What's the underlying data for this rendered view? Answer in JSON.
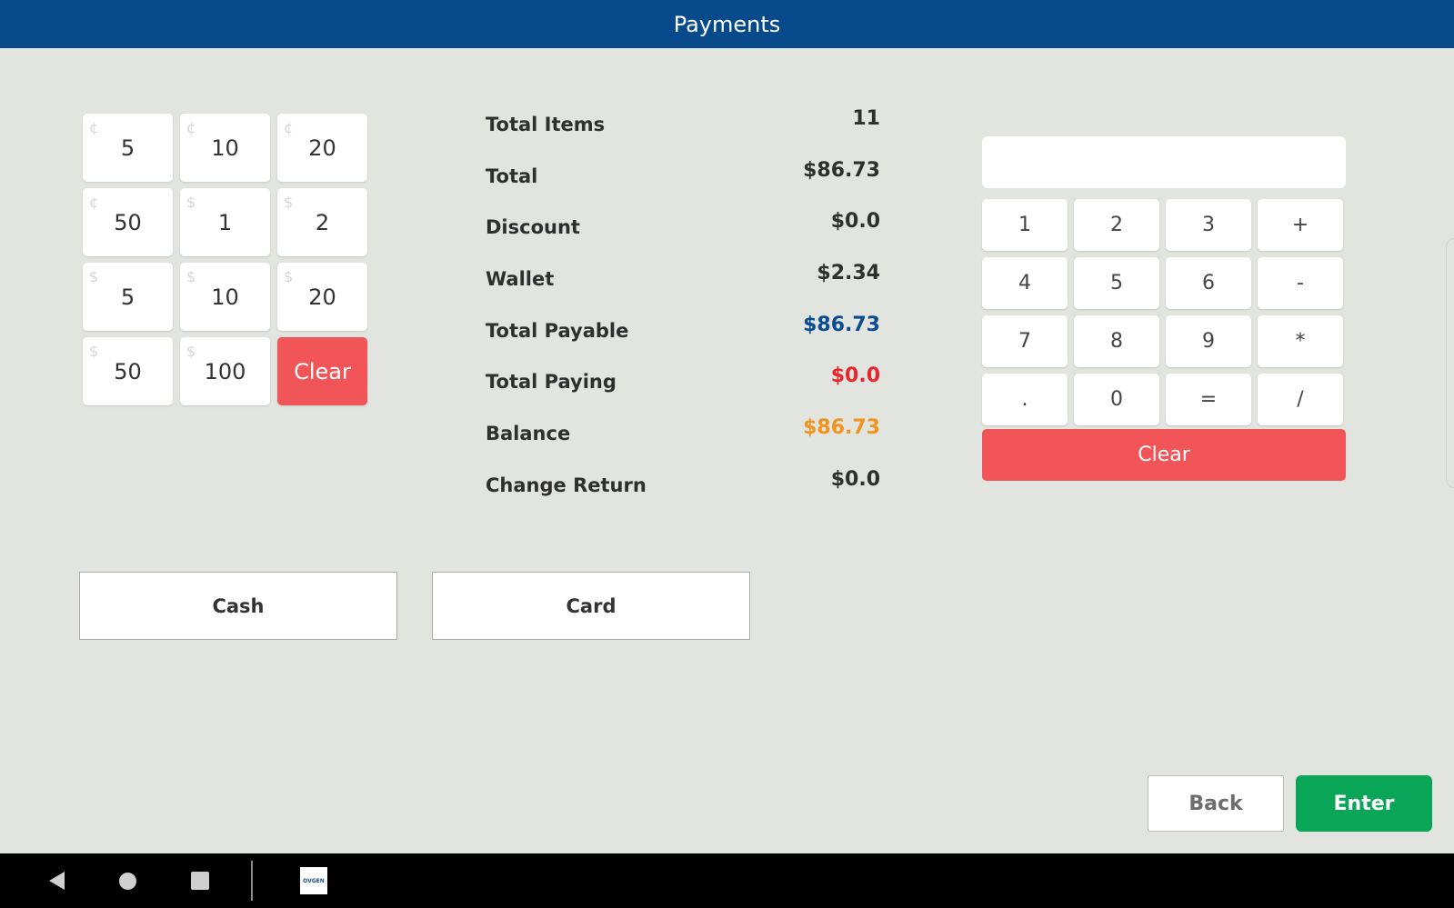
{
  "header": {
    "title": "Payments"
  },
  "denominations": [
    {
      "symbol": "¢",
      "value": "5"
    },
    {
      "symbol": "¢",
      "value": "10"
    },
    {
      "symbol": "¢",
      "value": "20"
    },
    {
      "symbol": "¢",
      "value": "50"
    },
    {
      "symbol": "$",
      "value": "1"
    },
    {
      "symbol": "$",
      "value": "2"
    },
    {
      "symbol": "$",
      "value": "5"
    },
    {
      "symbol": "$",
      "value": "10"
    },
    {
      "symbol": "$",
      "value": "20"
    },
    {
      "symbol": "$",
      "value": "50"
    },
    {
      "symbol": "$",
      "value": "100"
    }
  ],
  "denom_clear_label": "Clear",
  "summary": [
    {
      "label": "Total Items",
      "value": "11",
      "color": "#2f2f2f"
    },
    {
      "label": "Total",
      "value": "$86.73",
      "color": "#2f2f2f"
    },
    {
      "label": "Discount",
      "value": "$0.0",
      "color": "#2f2f2f"
    },
    {
      "label": "Wallet",
      "value": "$2.34",
      "color": "#2f2f2f"
    },
    {
      "label": "Total Payable",
      "value": "$86.73",
      "color": "#0b4c90"
    },
    {
      "label": "Total Paying",
      "value": "$0.0",
      "color": "#e8252a"
    },
    {
      "label": "Balance",
      "value": "$86.73",
      "color": "#f0941e"
    },
    {
      "label": "Change Return",
      "value": "$0.0",
      "color": "#2f2f2f"
    }
  ],
  "payment_methods": {
    "cash": "Cash",
    "card": "Card"
  },
  "calculator": {
    "display_value": "",
    "keys": [
      "1",
      "2",
      "3",
      "+",
      "4",
      "5",
      "6",
      "-",
      "7",
      "8",
      "9",
      "*",
      ".",
      "0",
      "=",
      "/"
    ],
    "clear_label": "Clear"
  },
  "actions": {
    "back": "Back",
    "enter": "Enter"
  },
  "colors": {
    "header": "#074a8b",
    "clear": "#f25557",
    "enter": "#0aa657"
  },
  "navbar": {
    "app_icon_text": "OVGEN"
  }
}
